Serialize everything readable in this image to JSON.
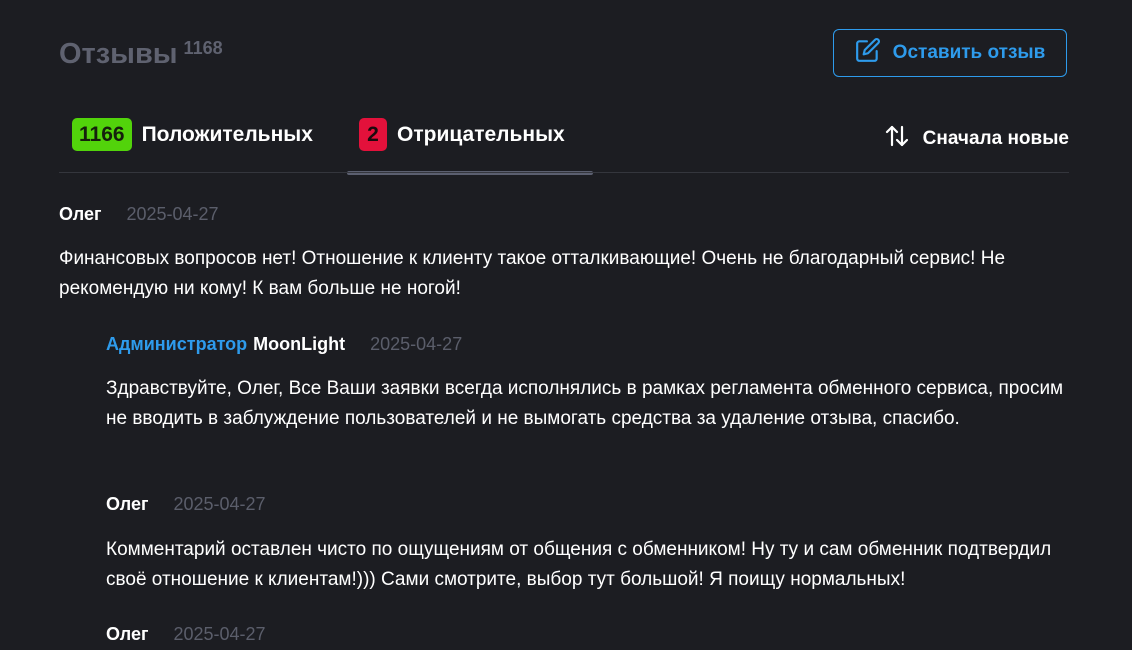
{
  "header": {
    "title": "Отзывы",
    "count": "1168",
    "leave_review_label": "Оставить отзыв",
    "leave_review_icon": "edit-icon",
    "accent_color": "#2e9bec"
  },
  "tabs": {
    "positive": {
      "count": "1166",
      "label": "Положительных",
      "color": "#52d30b"
    },
    "negative": {
      "count": "2",
      "label": "Отрицательных",
      "color": "#e3113b"
    },
    "active": "negative"
  },
  "sort": {
    "label": "Сначала новые",
    "icon": "sort-arrows-icon"
  },
  "reviews": [
    {
      "author": "Олег",
      "date": "2025-04-27",
      "text": "Финансовых вопросов нет! Отношение к клиенту такое отталкивающие! Очень не благодарный сервис! Не рекомендую ни кому! К вам больше не ногой!"
    },
    {
      "role": "Администратор",
      "author": "MoonLight",
      "date": "2025-04-27",
      "text": "Здравствуйте, Олег, Все Ваши заявки всегда исполнялись в рамках регламента обменного сервиса, просим не вводить в заблуждение пользователей и не вымогать средства за удаление отзыва, спасибо."
    },
    {
      "author": "Олег",
      "date": "2025-04-27",
      "text": "Комментарий оставлен чисто по ощущениям от общения с обменником! Ну ту и сам обменник подтвердил своё отношение к клиентам!))) Сами смотрите, выбор тут большой! Я поищу нормальных!"
    },
    {
      "author": "Олег",
      "date": "2025-04-27",
      "text": ""
    }
  ]
}
